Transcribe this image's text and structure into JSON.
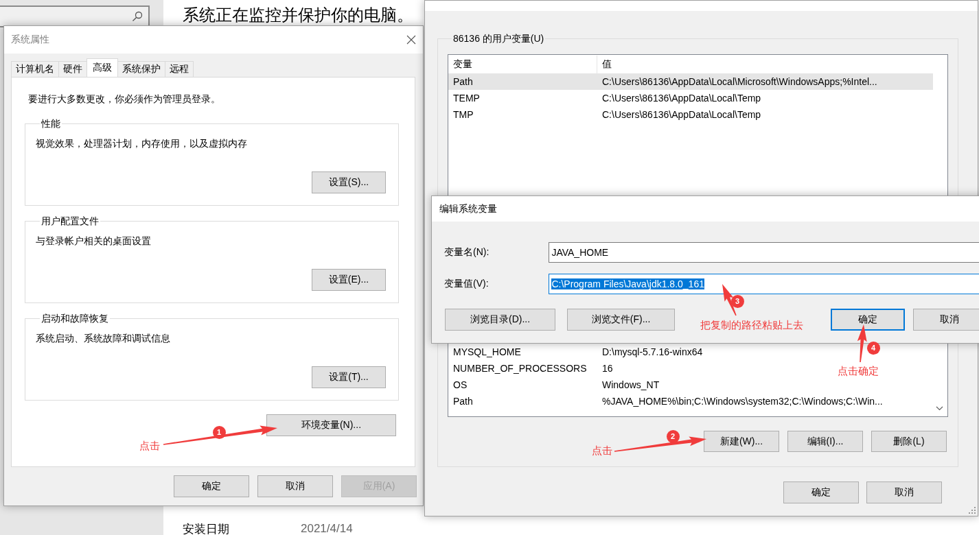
{
  "background": {
    "heading": "系统正在监控并保护你的电脑。",
    "info_rows": [
      {
        "label": "安装日期",
        "value": "2021/4/14"
      }
    ]
  },
  "system_properties": {
    "title": "系统属性",
    "tabs": [
      {
        "label": "计算机名",
        "selected": false
      },
      {
        "label": "硬件",
        "selected": false
      },
      {
        "label": "高级",
        "selected": true
      },
      {
        "label": "系统保护",
        "selected": false
      },
      {
        "label": "远程",
        "selected": false
      }
    ],
    "notice": "要进行大多数更改，你必须作为管理员登录。",
    "groups": [
      {
        "title": "性能",
        "description": "视觉效果，处理器计划，内存使用，以及虚拟内存",
        "button": "设置(S)..."
      },
      {
        "title": "用户配置文件",
        "description": "与登录帐户相关的桌面设置",
        "button": "设置(E)..."
      },
      {
        "title": "启动和故障恢复",
        "description": "系统启动、系统故障和调试信息",
        "button": "设置(T)..."
      }
    ],
    "env_button": "环境变量(N)...",
    "buttons": [
      {
        "label": "确定",
        "disabled": false
      },
      {
        "label": "取消",
        "disabled": false
      },
      {
        "label": "应用(A)",
        "disabled": true
      }
    ]
  },
  "environment_variables": {
    "user_group_title": "86136 的用户变量(U)",
    "columns": [
      "变量",
      "值"
    ],
    "user_rows": [
      {
        "name": "Path",
        "value": "C:\\Users\\86136\\AppData\\Local\\Microsoft\\WindowsApps;%Intel...",
        "selected": true
      },
      {
        "name": "TEMP",
        "value": "C:\\Users\\86136\\AppData\\Local\\Temp",
        "selected": false
      },
      {
        "name": "TMP",
        "value": "C:\\Users\\86136\\AppData\\Local\\Temp",
        "selected": false
      }
    ],
    "system_rows": [
      {
        "name": "MYSQL_HOME",
        "value": "D:\\mysql-5.7.16-winx64"
      },
      {
        "name": "NUMBER_OF_PROCESSORS",
        "value": "16"
      },
      {
        "name": "OS",
        "value": "Windows_NT"
      },
      {
        "name": "Path",
        "value": "%JAVA_HOME%\\bin;C:\\Windows\\system32;C:\\Windows;C:\\Win..."
      }
    ],
    "system_buttons": [
      "新建(W)...",
      "编辑(I)...",
      "删除(L)"
    ],
    "buttons": [
      "确定",
      "取消"
    ]
  },
  "edit_dialog": {
    "title": "编辑系统变量",
    "fields": [
      {
        "label": "变量名(N):",
        "value": "JAVA_HOME",
        "focused": false,
        "text_selected": false
      },
      {
        "label": "变量值(V):",
        "value": "C:\\Program Files\\Java\\jdk1.8.0_161",
        "focused": true,
        "text_selected": true
      }
    ],
    "buttons": [
      {
        "label": "浏览目录(D)...",
        "default": false
      },
      {
        "label": "浏览文件(F)...",
        "default": false
      },
      {
        "label": "确定",
        "default": true
      },
      {
        "label": "取消",
        "default": false
      }
    ]
  },
  "annotations": [
    {
      "number": "1",
      "text": "点击"
    },
    {
      "number": "2",
      "text": "点击"
    },
    {
      "number": "3",
      "text": "把复制的路径粘贴上去"
    },
    {
      "number": "4",
      "text": "点击确定"
    }
  ]
}
